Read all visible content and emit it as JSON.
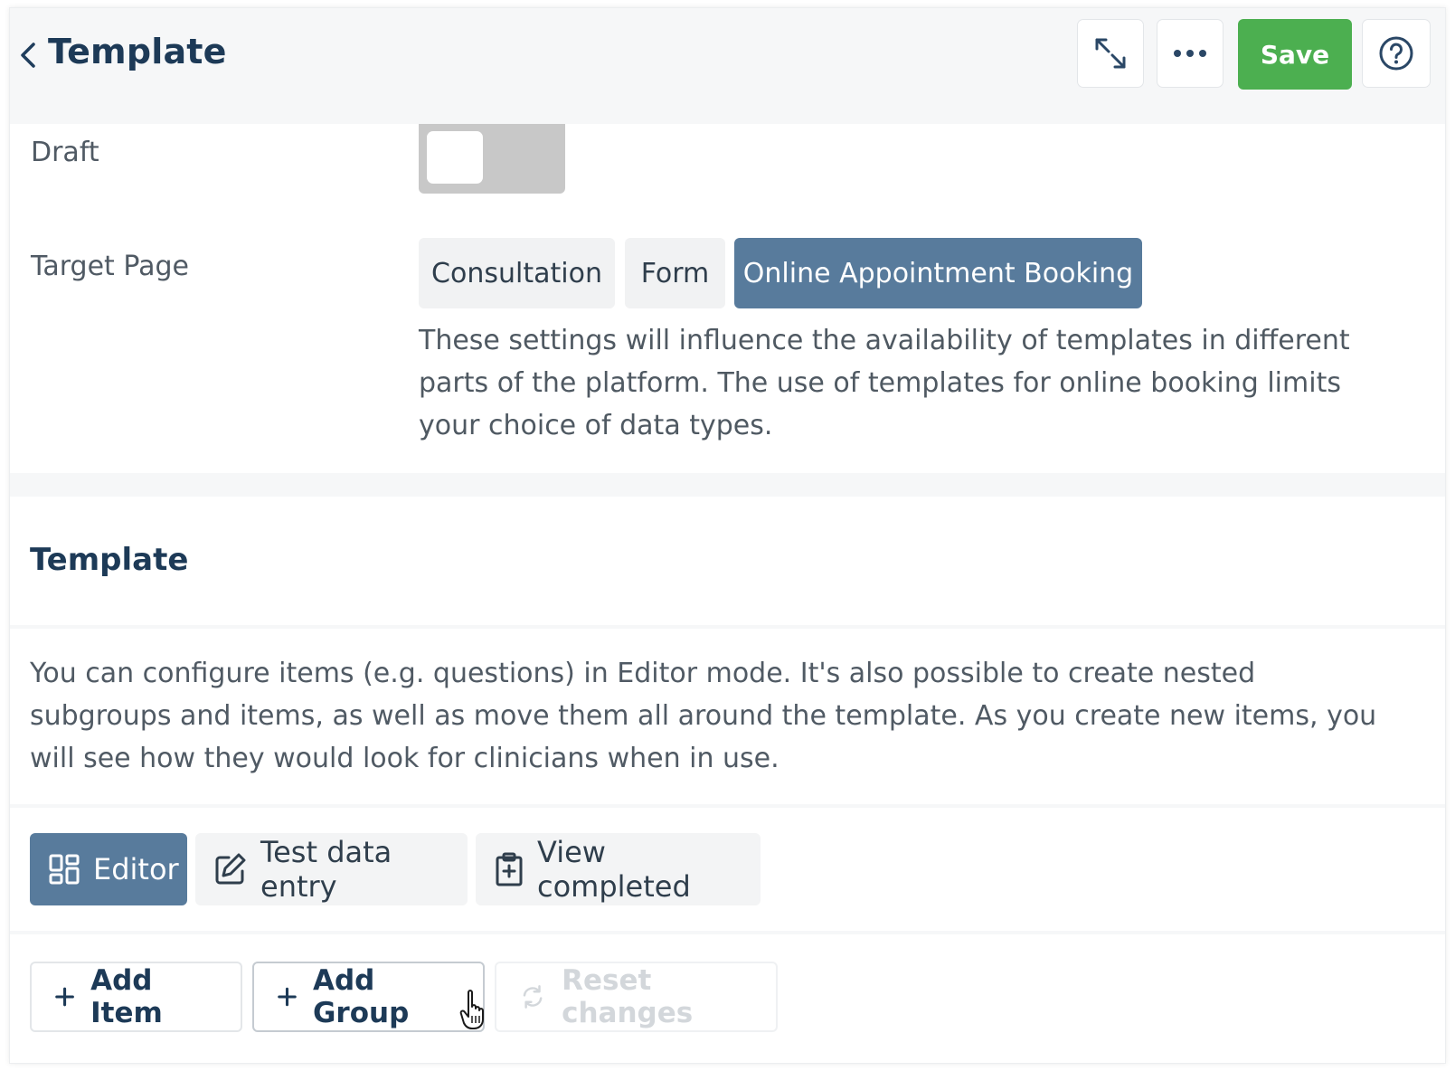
{
  "header": {
    "title": "Template",
    "save_label": "Save",
    "icons": {
      "back": "chevron-left-icon",
      "expand": "expand-arrows-icon",
      "more": "more-horizontal-icon",
      "help": "help-circle-icon"
    }
  },
  "settings": {
    "draft_label": "Draft",
    "draft_enabled": false,
    "target_page_label": "Target Page",
    "target_options": [
      "Consultation",
      "Form",
      "Online Appointment Booking"
    ],
    "selected_target": "Online Appointment Booking",
    "help_text": "These settings will influence the availability of templates in different parts of the platform. The use of templates for online booking limits your choice of data types."
  },
  "template_section": {
    "title": "Template",
    "description": "You can configure items (e.g. questions) in Editor mode. It's also possible to create nested subgroups and items, as well as move them all around the template. As you create new items, you will see how they would look for clinicians when in use."
  },
  "tabs": [
    {
      "label": "Editor",
      "icon": "dashboard-icon",
      "active": true
    },
    {
      "label": "Test data entry",
      "icon": "edit-icon",
      "active": false
    },
    {
      "label": "View completed",
      "icon": "clipboard-icon",
      "active": false
    }
  ],
  "actions": {
    "add_item": "Add Item",
    "add_group": "Add Group",
    "reset_changes": "Reset changes"
  },
  "colors": {
    "accent": "#587b9c",
    "save": "#4caf50",
    "title": "#1d3a57",
    "toggle_off": "#c8c8c8"
  }
}
